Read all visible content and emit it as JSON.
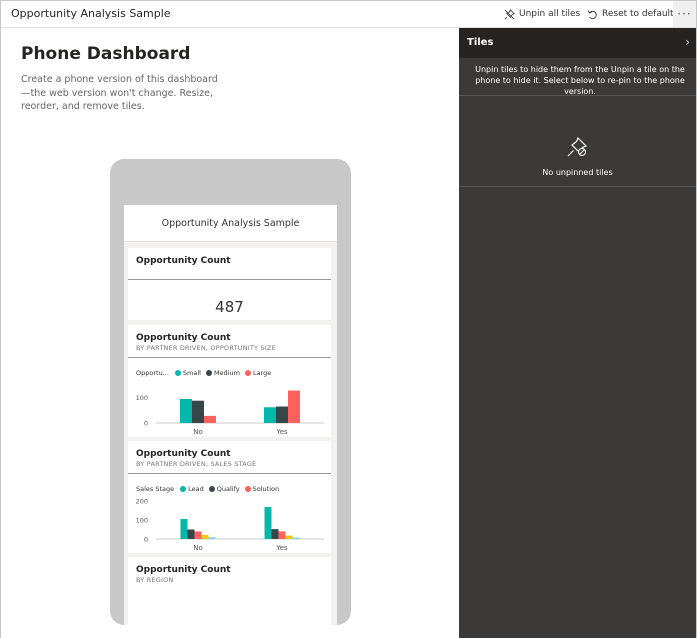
{
  "app": {
    "title": "Opportunity Analysis Sample"
  },
  "toolbar": {
    "unpin_all_label": "Unpin all tiles",
    "reset_label": "Reset to default",
    "more_label": "···"
  },
  "left": {
    "title": "Phone Dashboard",
    "description": "Create a phone version of this dashboard—the web version won't change. Resize, reorder, and remove tiles."
  },
  "phone": {
    "header": "Opportunity Analysis Sample",
    "tiles": [
      {
        "title": "Opportunity Count",
        "subtitle": "",
        "value": "487"
      },
      {
        "title": "Opportunity Count",
        "subtitle": "BY PARTNER DRIVEN, OPPORTUNITY SIZE"
      },
      {
        "title": "Opportunity Count",
        "subtitle": "BY PARTNER DRIVEN, SALES STAGE"
      },
      {
        "title": "Opportunity Count",
        "subtitle": "BY REGION"
      }
    ]
  },
  "chart_data": [
    {
      "type": "bar",
      "legend_title": "Opportu...",
      "categories": [
        "No",
        "Yes"
      ],
      "yticks": [
        "100",
        "0"
      ],
      "ylim": [
        0,
        150
      ],
      "series": [
        {
          "name": "Small",
          "color": "#01B8AA",
          "values": [
            95,
            62
          ]
        },
        {
          "name": "Medium",
          "color": "#374649",
          "values": [
            88,
            65
          ]
        },
        {
          "name": "Large",
          "color": "#FD625E",
          "values": [
            28,
            128
          ]
        }
      ]
    },
    {
      "type": "bar",
      "legend_title": "Sales Stage",
      "categories": [
        "No",
        "Yes"
      ],
      "yticks": [
        "200",
        "100",
        "0"
      ],
      "ylim": [
        0,
        200
      ],
      "series": [
        {
          "name": "Lead",
          "color": "#01B8AA",
          "values": [
            105,
            168
          ]
        },
        {
          "name": "Qualify",
          "color": "#374649",
          "values": [
            50,
            52
          ]
        },
        {
          "name": "Solution",
          "color": "#FD625E",
          "values": [
            40,
            40
          ]
        },
        {
          "name": "",
          "color": "#F2C80F",
          "values": [
            22,
            18
          ]
        },
        {
          "name": "",
          "color": "#8AD4EB",
          "values": [
            10,
            8
          ]
        }
      ]
    }
  ],
  "tiles_pane": {
    "title": "Tiles",
    "chevron": "›",
    "description": "Unpin tiles to hide them from the Unpin a tile on the phone to hide it. Select below to re-pin to the phone version.",
    "empty_text": "No unpinned tiles",
    "empty_icon": "unpin-icon"
  }
}
